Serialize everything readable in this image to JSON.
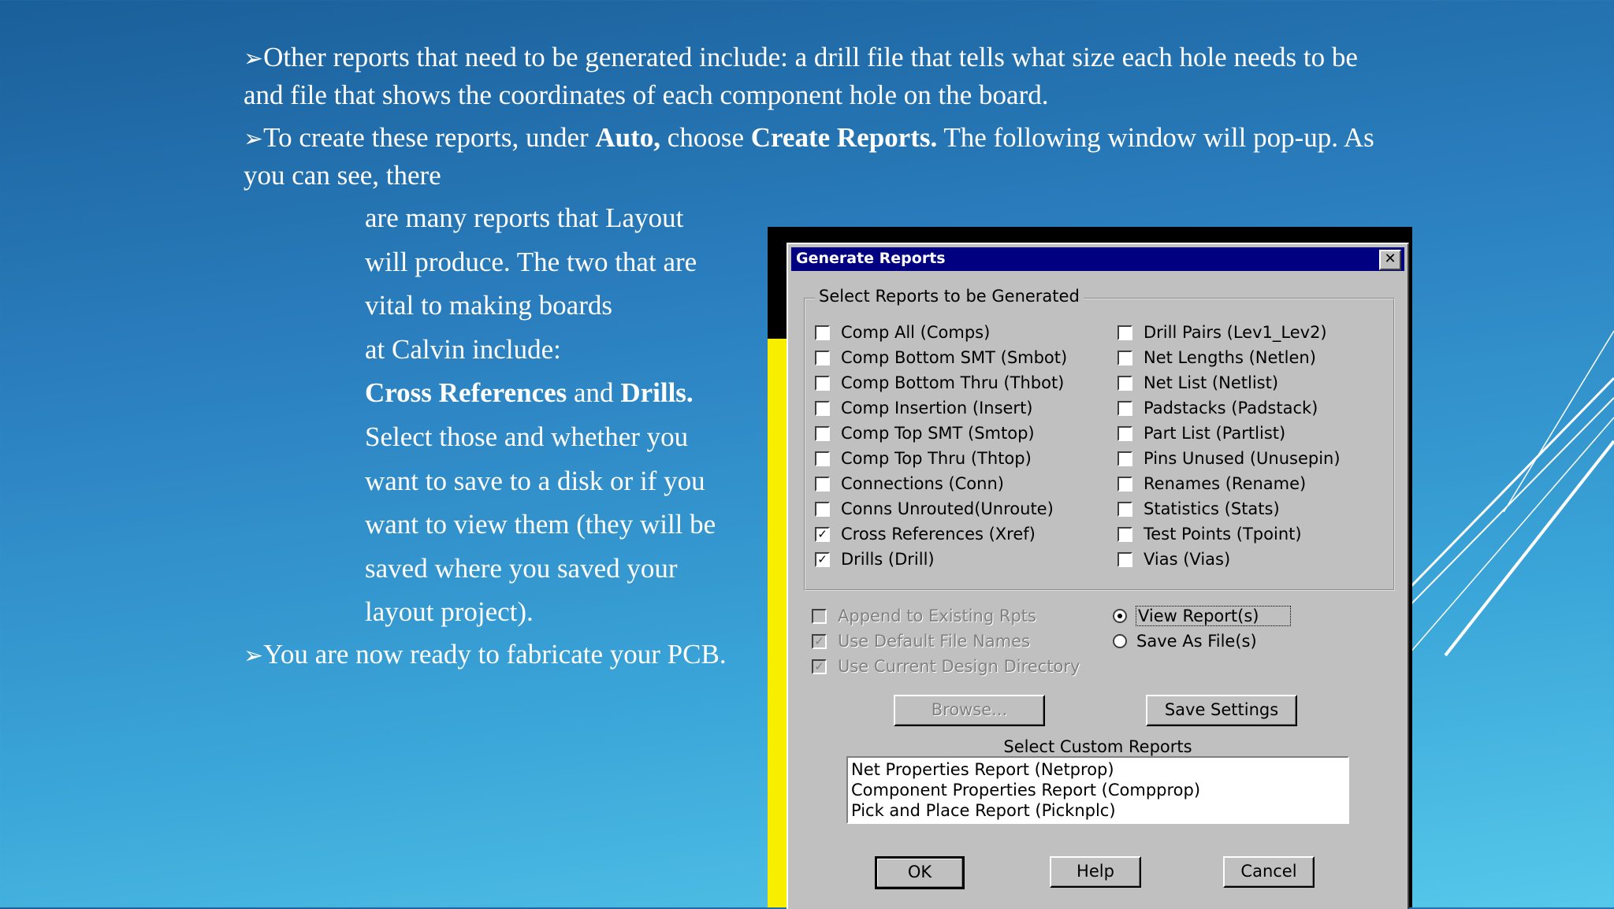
{
  "slide": {
    "bullet_glyph": "➢",
    "p1": "Other reports that need to be generated include: a drill file that tells what size each hole needs to be and file that shows the coordinates of each component hole on the      board.",
    "p2_a": "To create these reports, under ",
    "p2_auto": "Auto,",
    "p2_b": " choose ",
    "p2_create": "Create Reports.",
    "p2_c": "  The following window will pop-up.  As you can see, there",
    "indent_lines": [
      "are many reports that Layout",
      "will produce.  The two that are",
      "vital to making boards",
      "at Calvin include:"
    ],
    "cross_ref": "Cross References",
    "and_word": " and ",
    "drills": "Drills.",
    "indent_lines_2": [
      "Select those and whether you",
      "want to save to a disk or if you",
      "want to view them (they will be",
      "saved where you saved your",
      "layout project)."
    ],
    "p4": "You are now ready to fabricate your PCB."
  },
  "dialog": {
    "title": "Generate Reports",
    "close_glyph": "✕",
    "group_label": "Select Reports to be Generated",
    "left_reports": [
      {
        "label": "Comp All (Comps)",
        "checked": false
      },
      {
        "label": "Comp Bottom SMT (Smbot)",
        "checked": false
      },
      {
        "label": "Comp Bottom Thru (Thbot)",
        "checked": false
      },
      {
        "label": "Comp Insertion (Insert)",
        "checked": false
      },
      {
        "label": "Comp Top SMT (Smtop)",
        "checked": false
      },
      {
        "label": "Comp Top Thru (Thtop)",
        "checked": false
      },
      {
        "label": "Connections (Conn)",
        "checked": false
      },
      {
        "label": "Conns Unrouted(Unroute)",
        "checked": false
      },
      {
        "label": "Cross References (Xref)",
        "checked": true
      },
      {
        "label": "Drills (Drill)",
        "checked": true
      }
    ],
    "right_reports": [
      {
        "label": "Drill Pairs (Lev1_Lev2)",
        "checked": false
      },
      {
        "label": "Net Lengths (Netlen)",
        "checked": false
      },
      {
        "label": "Net List (Netlist)",
        "checked": false
      },
      {
        "label": "Padstacks (Padstack)",
        "checked": false
      },
      {
        "label": "Part List (Partlist)",
        "checked": false
      },
      {
        "label": "Pins Unused (Unusepin)",
        "checked": false
      },
      {
        "label": "Renames (Rename)",
        "checked": false
      },
      {
        "label": "Statistics (Stats)",
        "checked": false
      },
      {
        "label": "Test Points (Tpoint)",
        "checked": false
      },
      {
        "label": "Vias (Vias)",
        "checked": false
      }
    ],
    "options": [
      {
        "label": "Append to Existing Rpts",
        "checked": false
      },
      {
        "label": "Use Default File Names",
        "checked": true
      },
      {
        "label": "Use Current Design Directory",
        "checked": true
      }
    ],
    "output_mode": [
      {
        "label": "View Report(s)",
        "selected": true
      },
      {
        "label": "Save As File(s)",
        "selected": false
      }
    ],
    "browse_label": "Browse...",
    "save_settings_label": "Save Settings",
    "custom_label": "Select Custom Reports",
    "custom_reports": [
      "Net Properties Report  (Netprop)",
      "Component Properties Report  (Compprop)",
      "Pick and Place Report  (Picknplc)"
    ],
    "ok_label": "OK",
    "help_label": "Help",
    "cancel_label": "Cancel"
  }
}
